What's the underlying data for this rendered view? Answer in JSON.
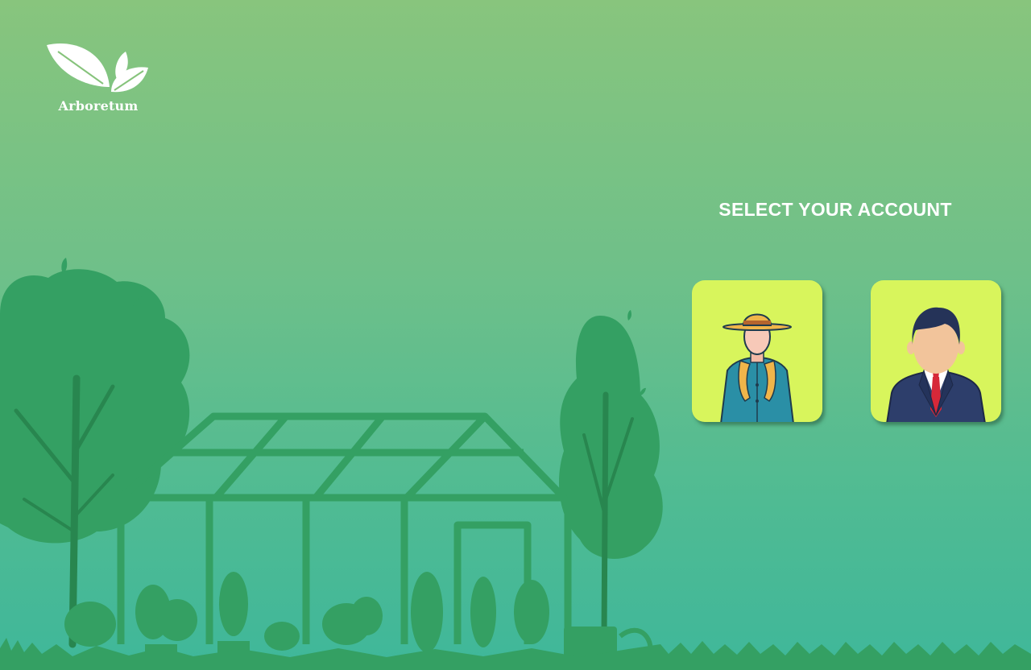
{
  "app": {
    "logo_text": "Arboretum",
    "logo_icon": "leaves-icon"
  },
  "login": {
    "title": "SELECT YOUR ACCOUNT",
    "accounts": [
      {
        "icon": "farmer-avatar-icon"
      },
      {
        "icon": "businessman-avatar-icon"
      }
    ]
  },
  "colors": {
    "background_top": "#88c57d",
    "background_bottom": "#3fb79a",
    "silhouette": "#2e9e60",
    "card": "#d8f55c",
    "text": "#ffffff"
  }
}
